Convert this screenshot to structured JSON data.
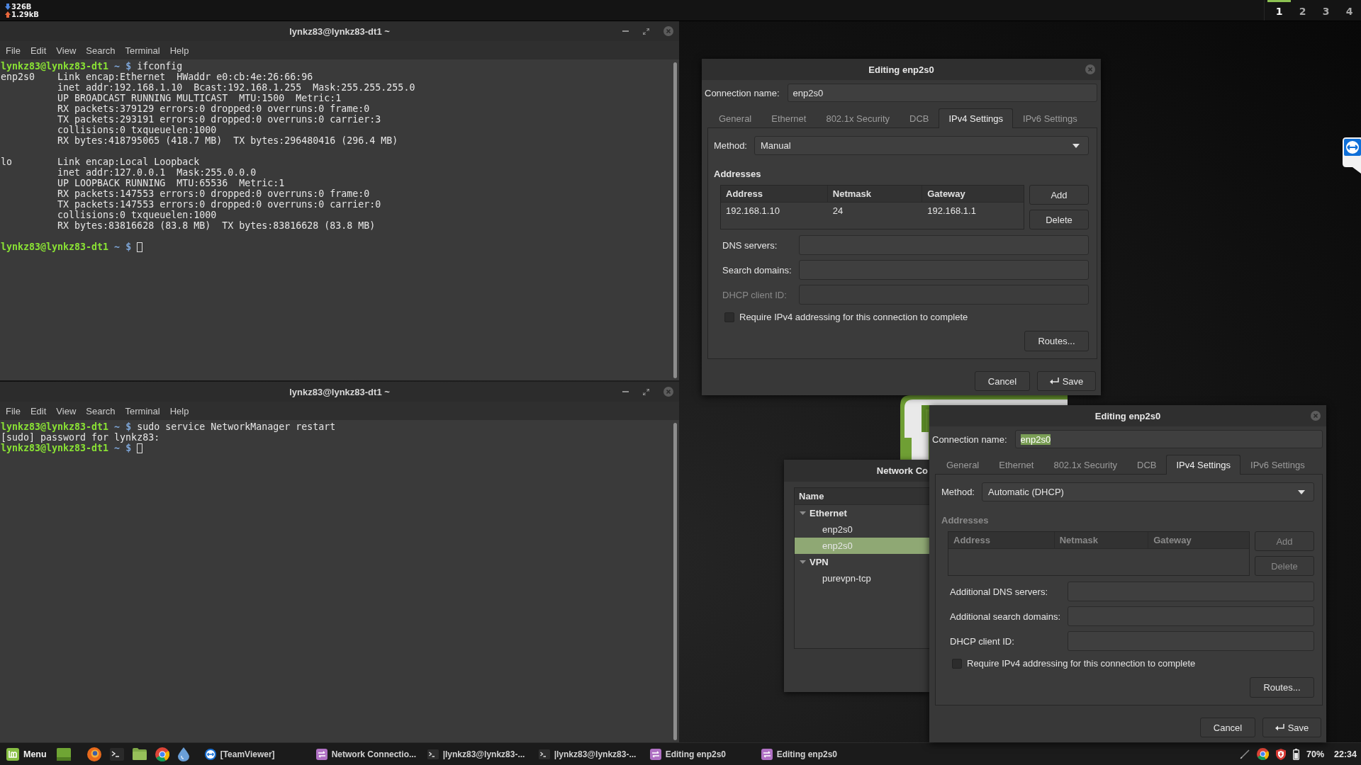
{
  "top_panel": {
    "net_speed": [
      {
        "kind": "down",
        "value": "326B"
      },
      {
        "kind": "up",
        "value": "1.29kB"
      }
    ],
    "workspaces": [
      {
        "label": "1",
        "selected": true
      },
      {
        "label": "2",
        "selected": false
      },
      {
        "label": "3",
        "selected": false
      },
      {
        "label": "4",
        "selected": false
      }
    ]
  },
  "terminals": [
    {
      "title": "lynkz83@lynkz83-dt1 ~",
      "menu": [
        "File",
        "Edit",
        "View",
        "Search",
        "Terminal",
        "Help"
      ],
      "lines": [
        {
          "kind": "prompt",
          "user_host": "lynkz83@lynkz83-dt1",
          "path": "~",
          "symbol": "$",
          "command": "ifconfig",
          "cursor": false
        },
        {
          "kind": "iface",
          "iface": "enp2s0",
          "text": "Link encap:Ethernet  HWaddr e0:cb:4e:26:66:96"
        },
        {
          "kind": "detail",
          "text": "inet addr:192.168.1.10  Bcast:192.168.1.255  Mask:255.255.255.0"
        },
        {
          "kind": "detail",
          "text": "UP BROADCAST RUNNING MULTICAST  MTU:1500  Metric:1"
        },
        {
          "kind": "detail",
          "text": "RX packets:379129 errors:0 dropped:0 overruns:0 frame:0"
        },
        {
          "kind": "detail",
          "text": "TX packets:293191 errors:0 dropped:0 overruns:0 carrier:3"
        },
        {
          "kind": "detail",
          "text": "collisions:0 txqueuelen:1000"
        },
        {
          "kind": "detail",
          "text": "RX bytes:418795065 (418.7 MB)  TX bytes:296480416 (296.4 MB)"
        },
        {
          "kind": "blank"
        },
        {
          "kind": "iface",
          "iface": "lo",
          "text": "Link encap:Local Loopback"
        },
        {
          "kind": "detail",
          "text": "inet addr:127.0.0.1  Mask:255.0.0.0"
        },
        {
          "kind": "detail",
          "text": "UP LOOPBACK RUNNING  MTU:65536  Metric:1"
        },
        {
          "kind": "detail",
          "text": "RX packets:147553 errors:0 dropped:0 overruns:0 frame:0"
        },
        {
          "kind": "detail",
          "text": "TX packets:147553 errors:0 dropped:0 overruns:0 carrier:0"
        },
        {
          "kind": "detail",
          "text": "collisions:0 txqueuelen:1000"
        },
        {
          "kind": "detail",
          "text": "RX bytes:83816628 (83.8 MB)  TX bytes:83816628 (83.8 MB)"
        },
        {
          "kind": "blank"
        },
        {
          "kind": "prompt",
          "user_host": "lynkz83@lynkz83-dt1",
          "path": "~",
          "symbol": "$",
          "cursor": true
        }
      ]
    },
    {
      "title": "lynkz83@lynkz83-dt1 ~",
      "menu": [
        "File",
        "Edit",
        "View",
        "Search",
        "Terminal",
        "Help"
      ],
      "lines": [
        {
          "kind": "prompt",
          "user_host": "lynkz83@lynkz83-dt1",
          "path": "~",
          "symbol": "$",
          "command": "sudo service NetworkManager restart",
          "cursor": false
        },
        {
          "kind": "plain",
          "text": "[sudo] password for lynkz83:"
        },
        {
          "kind": "prompt",
          "user_host": "lynkz83@lynkz83-dt1",
          "path": "~",
          "symbol": "$",
          "cursor": true
        }
      ]
    }
  ],
  "editor_dialogs": [
    {
      "title": "Editing enp2s0",
      "connection_name": {
        "label": "Connection name:",
        "value": "enp2s0",
        "text_selected": false
      },
      "tabs": [
        {
          "label": "General",
          "selected": false
        },
        {
          "label": "Ethernet",
          "selected": false
        },
        {
          "label": "802.1x Security",
          "selected": false
        },
        {
          "label": "DCB",
          "selected": false
        },
        {
          "label": "IPv4 Settings",
          "selected": true
        },
        {
          "label": "IPv6 Settings",
          "selected": false
        }
      ],
      "method": {
        "label": "Method:",
        "value": "Manual"
      },
      "addresses": {
        "heading": "Addresses",
        "disabled": false,
        "columns": [
          "Address",
          "Netmask",
          "Gateway"
        ],
        "rows": [
          [
            "192.168.1.10",
            "24",
            "192.168.1.1"
          ]
        ]
      },
      "address_buttons": [
        {
          "label": "Add",
          "disabled": false
        },
        {
          "label": "Delete",
          "disabled": false
        }
      ],
      "fields": [
        {
          "label": "DNS servers:",
          "disabled": false
        },
        {
          "label": "Search domains:",
          "disabled": false
        },
        {
          "label": "DHCP client ID:",
          "disabled": true
        }
      ],
      "require_checkbox": {
        "label": "Require IPv4 addressing for this connection to complete",
        "checked": false
      },
      "routes_button": "Routes...",
      "buttons": [
        {
          "label": "Cancel",
          "kind": "normal"
        },
        {
          "label": "Save",
          "kind": "default"
        }
      ]
    },
    {
      "title": "Editing enp2s0",
      "connection_name": {
        "label": "Connection name:",
        "value": "enp2s0",
        "text_selected": true
      },
      "tabs": [
        {
          "label": "General",
          "selected": false
        },
        {
          "label": "Ethernet",
          "selected": false
        },
        {
          "label": "802.1x Security",
          "selected": false
        },
        {
          "label": "DCB",
          "selected": false
        },
        {
          "label": "IPv4 Settings",
          "selected": true
        },
        {
          "label": "IPv6 Settings",
          "selected": false
        }
      ],
      "method": {
        "label": "Method:",
        "value": "Automatic (DHCP)"
      },
      "addresses": {
        "heading": "Addresses",
        "disabled": true,
        "columns": [
          "Address",
          "Netmask",
          "Gateway"
        ]
      },
      "address_buttons": [
        {
          "label": "Add",
          "disabled": true
        },
        {
          "label": "Delete",
          "disabled": true
        }
      ],
      "fields": [
        {
          "label": "Additional DNS servers:",
          "disabled": false
        },
        {
          "label": "Additional search domains:",
          "disabled": false
        },
        {
          "label": "DHCP client ID:",
          "disabled": false
        }
      ],
      "require_checkbox": {
        "label": "Require IPv4 addressing for this connection to complete",
        "checked": false
      },
      "routes_button": "Routes...",
      "buttons": [
        {
          "label": "Cancel",
          "kind": "normal"
        },
        {
          "label": "Save",
          "kind": "default"
        }
      ]
    }
  ],
  "connections_window": {
    "title": "Network Co",
    "column": "Name",
    "groups": [
      {
        "label": "Ethernet",
        "expanded": true,
        "selected": false,
        "children": [
          {
            "label": "enp2s0",
            "selected": false
          },
          {
            "label": "enp2s0",
            "selected": true
          }
        ]
      },
      {
        "label": "VPN",
        "expanded": true,
        "selected": false,
        "children": [
          {
            "label": "purevpn-tcp",
            "selected": false
          }
        ]
      }
    ]
  },
  "taskbar": {
    "menu_label": "Menu",
    "windows": [
      {
        "label": "[TeamViewer]",
        "kind": "remote"
      },
      {
        "label": "Network Connectio...",
        "kind": "network"
      },
      {
        "label": "|lynkz83@lynkz83-...",
        "kind": "terminal"
      },
      {
        "label": "|lynkz83@lynkz83-...",
        "kind": "terminal"
      },
      {
        "label": "Editing enp2s0",
        "kind": "network"
      },
      {
        "label": "Editing enp2s0",
        "kind": "network"
      }
    ],
    "battery": "70%",
    "clock": "22:34"
  }
}
